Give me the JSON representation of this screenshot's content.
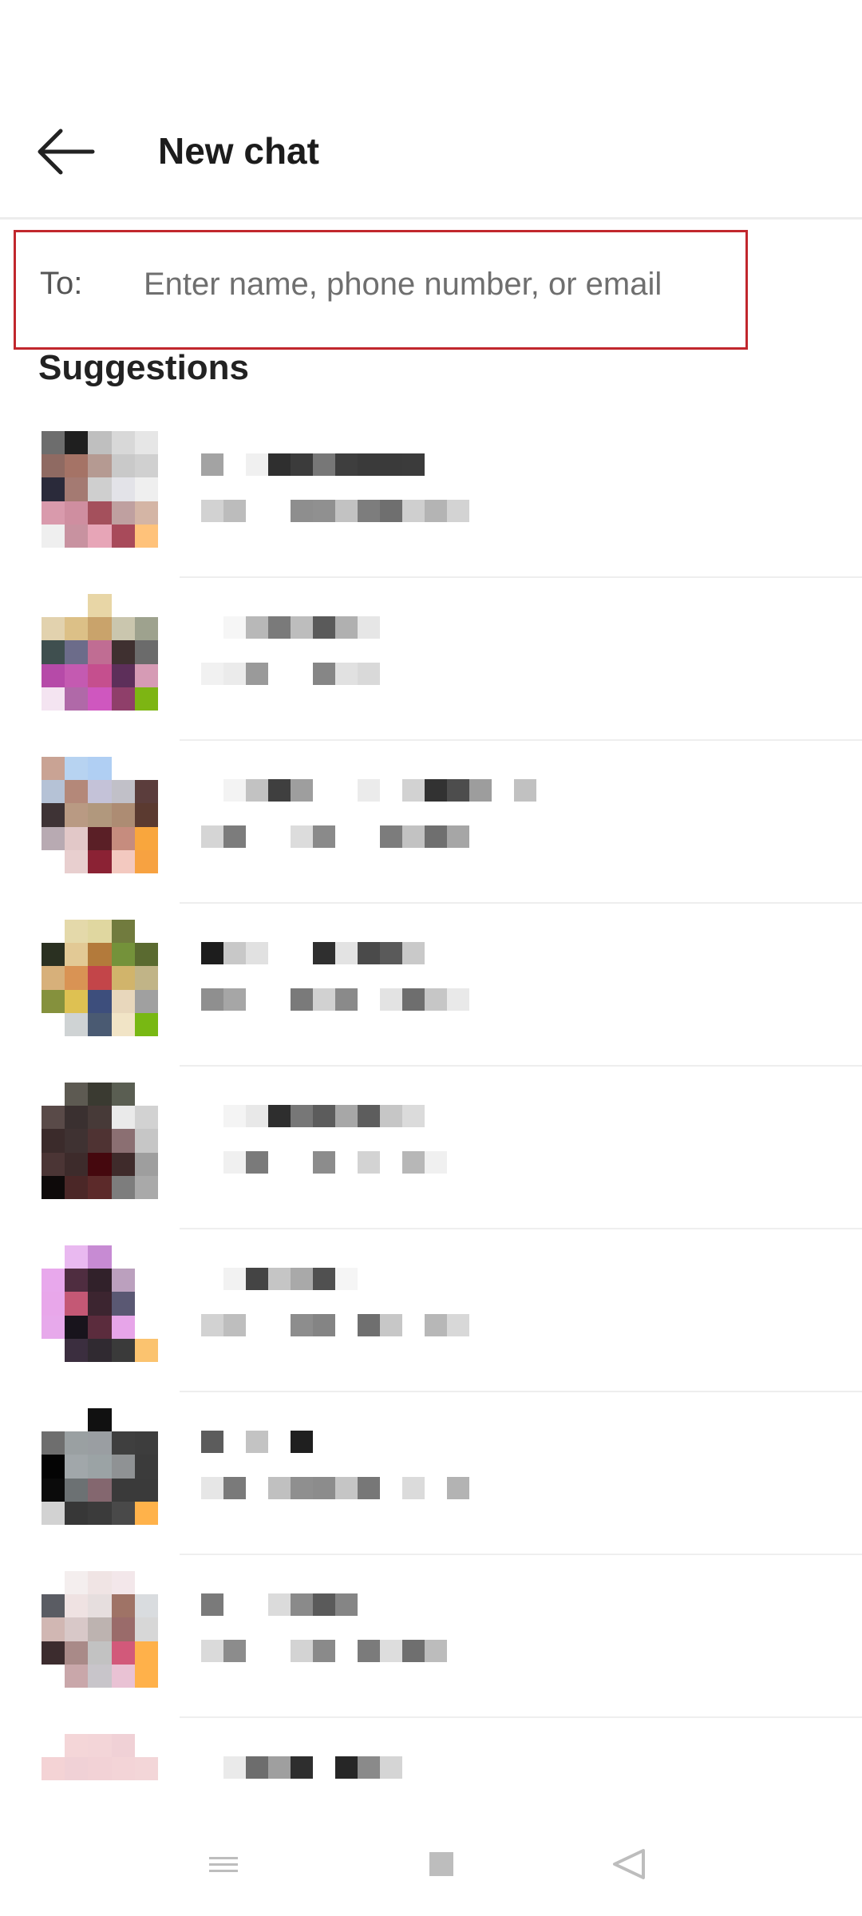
{
  "header": {
    "title": "New chat"
  },
  "to_field": {
    "label": "To:",
    "value": "",
    "placeholder": "Enter name, phone number, or email"
  },
  "suggestions": {
    "title": "Suggestions"
  },
  "contacts": [
    {
      "avatar": [
        "#6d6d6d",
        "#1f1f1f",
        "#bfbfbf",
        "#d8d8d8",
        "#e6e6e6",
        "#8f6a62",
        "#a57366",
        "#b59a92",
        "#c9c9c9",
        "#d0d0d0",
        "#2a2a3a",
        "#a47a72",
        "#cfcfcf",
        "#e3e3e8",
        "#efefef",
        "#d99aac",
        "#cf8ea0",
        "#a4505c",
        "#bfa0a0",
        "#d4b5a5",
        "#efefef",
        "#c892a0",
        "#e7a5b7",
        "#a84a5a",
        "#ffc27a"
      ],
      "name_blocks": [
        "#a3a3a3",
        "#ffffff",
        "#f0f0f0",
        "#2f2f2f",
        "#3b3b3b",
        "#777777",
        "#3e3e3e",
        "#3a3a3a",
        "#3a3a3a",
        "#3b3b3b"
      ],
      "sub_blocks": [
        "#d2d2d2",
        "#bcbcbc",
        "#ffffff",
        "#ffffff",
        "#8e8e8e",
        "#909090",
        "#c2c2c2",
        "#7d7d7d",
        "#6f6f6f",
        "#cfcfcf",
        "#b4b4b4",
        "#d3d3d3"
      ]
    },
    {
      "avatar": [
        "#ffffff",
        "#ffffff",
        "#e8d6a6",
        "#ffffff",
        "#ffffff",
        "#e2d2ae",
        "#dcc087",
        "#c9a36b",
        "#cac6ae",
        "#9ea28e",
        "#3f4f4f",
        "#6c6c8a",
        "#c06d93",
        "#3f3030",
        "#6b6b6b",
        "#b64aa8",
        "#c45ab1",
        "#c54f8e",
        "#5d2f5a",
        "#d69bb5",
        "#f4e4f1",
        "#b069a8",
        "#cf57bf",
        "#8f3f6a",
        "#7db513"
      ],
      "name_blocks": [
        "#ffffff",
        "#f6f6f6",
        "#b8b8b8",
        "#7a7a7a",
        "#bdbdbd",
        "#5a5a5a",
        "#b0b0b0",
        "#e6e6e6"
      ],
      "sub_blocks": [
        "#f1f1f1",
        "#ebebeb",
        "#9a9a9a",
        "#ffffff",
        "#ffffff",
        "#868686",
        "#e1e1e1",
        "#d9d9d9"
      ]
    },
    {
      "avatar": [
        "#c9a394",
        "#b7d3f1",
        "#b0cff3",
        "#ffffff",
        "#ffffff",
        "#b5c2d6",
        "#b48879",
        "#c4c2d8",
        "#c1c0c8",
        "#5b3d3c",
        "#3e3335",
        "#b99a83",
        "#b1987d",
        "#ad8c73",
        "#5b3a30",
        "#b8aab2",
        "#e2c8c8",
        "#5a1f26",
        "#c68c7e",
        "#f9a63d",
        "#ffffff",
        "#e8cfcf",
        "#8b2234",
        "#f3c9c0",
        "#f7a241"
      ],
      "name_blocks": [
        "#ffffff",
        "#f3f3f3",
        "#c2c2c2",
        "#3f3f3f",
        "#9e9e9e",
        "#ffffff",
        "#ffffff",
        "#ebebeb",
        "#ffffff",
        "#d2d2d2",
        "#323232",
        "#4d4d4d",
        "#9d9d9d",
        "#ffffff",
        "#c1c1c1"
      ],
      "sub_blocks": [
        "#d5d5d5",
        "#7c7c7c",
        "#ffffff",
        "#ffffff",
        "#dcdcdc",
        "#8a8a8a",
        "#ffffff",
        "#ffffff",
        "#7c7c7c",
        "#c2c2c2",
        "#6f6f6f",
        "#a6a6a6"
      ]
    },
    {
      "avatar": [
        "#ffffff",
        "#e4d9aa",
        "#e0d7a0",
        "#717b3e",
        "#ffffff",
        "#2a3021",
        "#e2c995",
        "#b37a3b",
        "#74923a",
        "#5a6a30",
        "#d7b07a",
        "#d99354",
        "#c34549",
        "#d1b46b",
        "#c1b487",
        "#85913d",
        "#dec152",
        "#3d4e7c",
        "#e8d7bc",
        "#a0a0a0",
        "#ffffff",
        "#cfd3d4",
        "#4a5a72",
        "#f1e4c6",
        "#78b813"
      ],
      "name_blocks": [
        "#1d1d1d",
        "#c8c8c8",
        "#e1e1e1",
        "#ffffff",
        "#ffffff",
        "#2f2f2f",
        "#e3e3e3",
        "#4a4a4a",
        "#5a5a5a",
        "#c9c9c9"
      ],
      "sub_blocks": [
        "#8f8f8f",
        "#a6a6a6",
        "#ffffff",
        "#ffffff",
        "#7a7a7a",
        "#d1d1d1",
        "#8a8a8a",
        "#ffffff",
        "#e3e3e3",
        "#6e6e6e",
        "#c6c6c6",
        "#e9e9e9"
      ]
    },
    {
      "avatar": [
        "#ffffff",
        "#5d5a52",
        "#3a3a31",
        "#5a5e52",
        "#ffffff",
        "#594a48",
        "#3a3030",
        "#473a38",
        "#eaeaea",
        "#d2d2d2",
        "#3b2b2b",
        "#3f3232",
        "#4f3333",
        "#8b6f72",
        "#c6c6c6",
        "#4b3535",
        "#3d2b2b",
        "#45080e",
        "#3f2b2b",
        "#9e9e9e",
        "#0e0a0a",
        "#4b2727",
        "#5c2a2a",
        "#7d7d7d",
        "#a9a9a9"
      ],
      "name_blocks": [
        "#ffffff",
        "#f4f4f4",
        "#e8e8e8",
        "#2e2e2e",
        "#777777",
        "#5c5c5c",
        "#a7a7a7",
        "#5d5d5d",
        "#c6c6c6",
        "#dbdbdb"
      ],
      "sub_blocks": [
        "#ffffff",
        "#f0f0f0",
        "#7a7a7a",
        "#ffffff",
        "#ffffff",
        "#8c8c8c",
        "#ffffff",
        "#d3d3d3",
        "#ffffff",
        "#b7b7b7",
        "#f0f0f0",
        "#ffffff"
      ]
    },
    {
      "avatar": [
        "#ffffff",
        "#e9b9f0",
        "#c78bd3",
        "#ffffff",
        "#ffffff",
        "#e8a8ec",
        "#4f2d40",
        "#31212a",
        "#bba0be",
        "#ffffff",
        "#e8a7ea",
        "#c45875",
        "#3c2530",
        "#5a5873",
        "#ffffff",
        "#e7a9eb",
        "#18141c",
        "#5b2c3d",
        "#e7a5e9",
        "#ffffff",
        "#ffffff",
        "#3b2e3f",
        "#302a31",
        "#3a3a3a",
        "#fbc36f"
      ],
      "name_blocks": [
        "#ffffff",
        "#f2f2f2",
        "#444444",
        "#c5c5c5",
        "#a9a9a9",
        "#505050",
        "#f5f5f5"
      ],
      "sub_blocks": [
        "#d2d2d2",
        "#bebebe",
        "#ffffff",
        "#ffffff",
        "#8d8d8d",
        "#848484",
        "#ffffff",
        "#6f6f6f",
        "#c7c7c7",
        "#ffffff",
        "#b7b7b7",
        "#d8d8d8"
      ]
    },
    {
      "avatar": [
        "#ffffff",
        "#ffffff",
        "#111111",
        "#ffffff",
        "#ffffff",
        "#6e6e6e",
        "#9aa0a2",
        "#9a9ea2",
        "#3f3f3f",
        "#3d3d3d",
        "#040404",
        "#a1a7aa",
        "#9ba3a5",
        "#8f9294",
        "#3b3b3b",
        "#0b0b0b",
        "#6c7173",
        "#84676f",
        "#3a3a3a",
        "#3a3a3a",
        "#d2d2d2",
        "#373737",
        "#3b3b3b",
        "#494949",
        "#ffb24a"
      ],
      "name_blocks": [
        "#5c5c5c",
        "#ffffff",
        "#c3c3c3",
        "#ffffff",
        "#1f1f1f"
      ],
      "sub_blocks": [
        "#e6e6e6",
        "#7a7a7a",
        "#ffffff",
        "#c0c0c0",
        "#8f8f8f",
        "#8c8c8c",
        "#c5c5c5",
        "#777777",
        "#ffffff",
        "#dbdbdb",
        "#ffffff",
        "#b3b3b3"
      ]
    },
    {
      "avatar": [
        "#ffffff",
        "#f4eeee",
        "#f0e4e4",
        "#f3e7ea",
        "#ffffff",
        "#5a5c63",
        "#efe2e2",
        "#e6dede",
        "#9f7366",
        "#d9dcdf",
        "#d1b7b3",
        "#d8c8c8",
        "#bdb3b0",
        "#9a6b6a",
        "#d7d7d7",
        "#3c2c2e",
        "#a98a88",
        "#c2c2c2",
        "#d2597a",
        "#ffb14a",
        "#ffffff",
        "#c9a7aa",
        "#c8c5ca",
        "#e9c2d4",
        "#ffb14a"
      ],
      "name_blocks": [
        "#7a7a7a",
        "#ffffff",
        "#ffffff",
        "#dbdbdb",
        "#8a8a8a",
        "#5a5a5a",
        "#858585",
        "#ffffff",
        "#ffffff",
        "#ffffff"
      ],
      "sub_blocks": [
        "#dadada",
        "#8c8c8c",
        "#ffffff",
        "#ffffff",
        "#d3d3d3",
        "#8a8a8a",
        "#ffffff",
        "#7b7b7b",
        "#dddddd",
        "#6f6f6f",
        "#bcbcbc",
        "#ffffff"
      ]
    },
    {
      "avatar": [
        "#ffffff",
        "#f4d6d8",
        "#f3d5d8",
        "#f0d1d6",
        "#ffffff",
        "#f4d3d5",
        "#f0d1d6",
        "#f2d2d6",
        "#f3d4d7",
        "#f3d6d8",
        "#ffffff",
        "#ffffff",
        "#ffffff",
        "#ffffff",
        "#ffffff",
        "#ffffff",
        "#ffffff",
        "#ffffff",
        "#ffffff",
        "#ffffff",
        "#ffffff",
        "#ffffff",
        "#ffffff",
        "#ffffff",
        "#ffffff"
      ],
      "name_blocks": [
        "#ffffff",
        "#eaeaea",
        "#6d6d6d",
        "#9f9f9f",
        "#2e2e2e",
        "#ffffff",
        "#262626",
        "#8a8a8a",
        "#d5d5d5"
      ],
      "sub_blocks": []
    }
  ]
}
